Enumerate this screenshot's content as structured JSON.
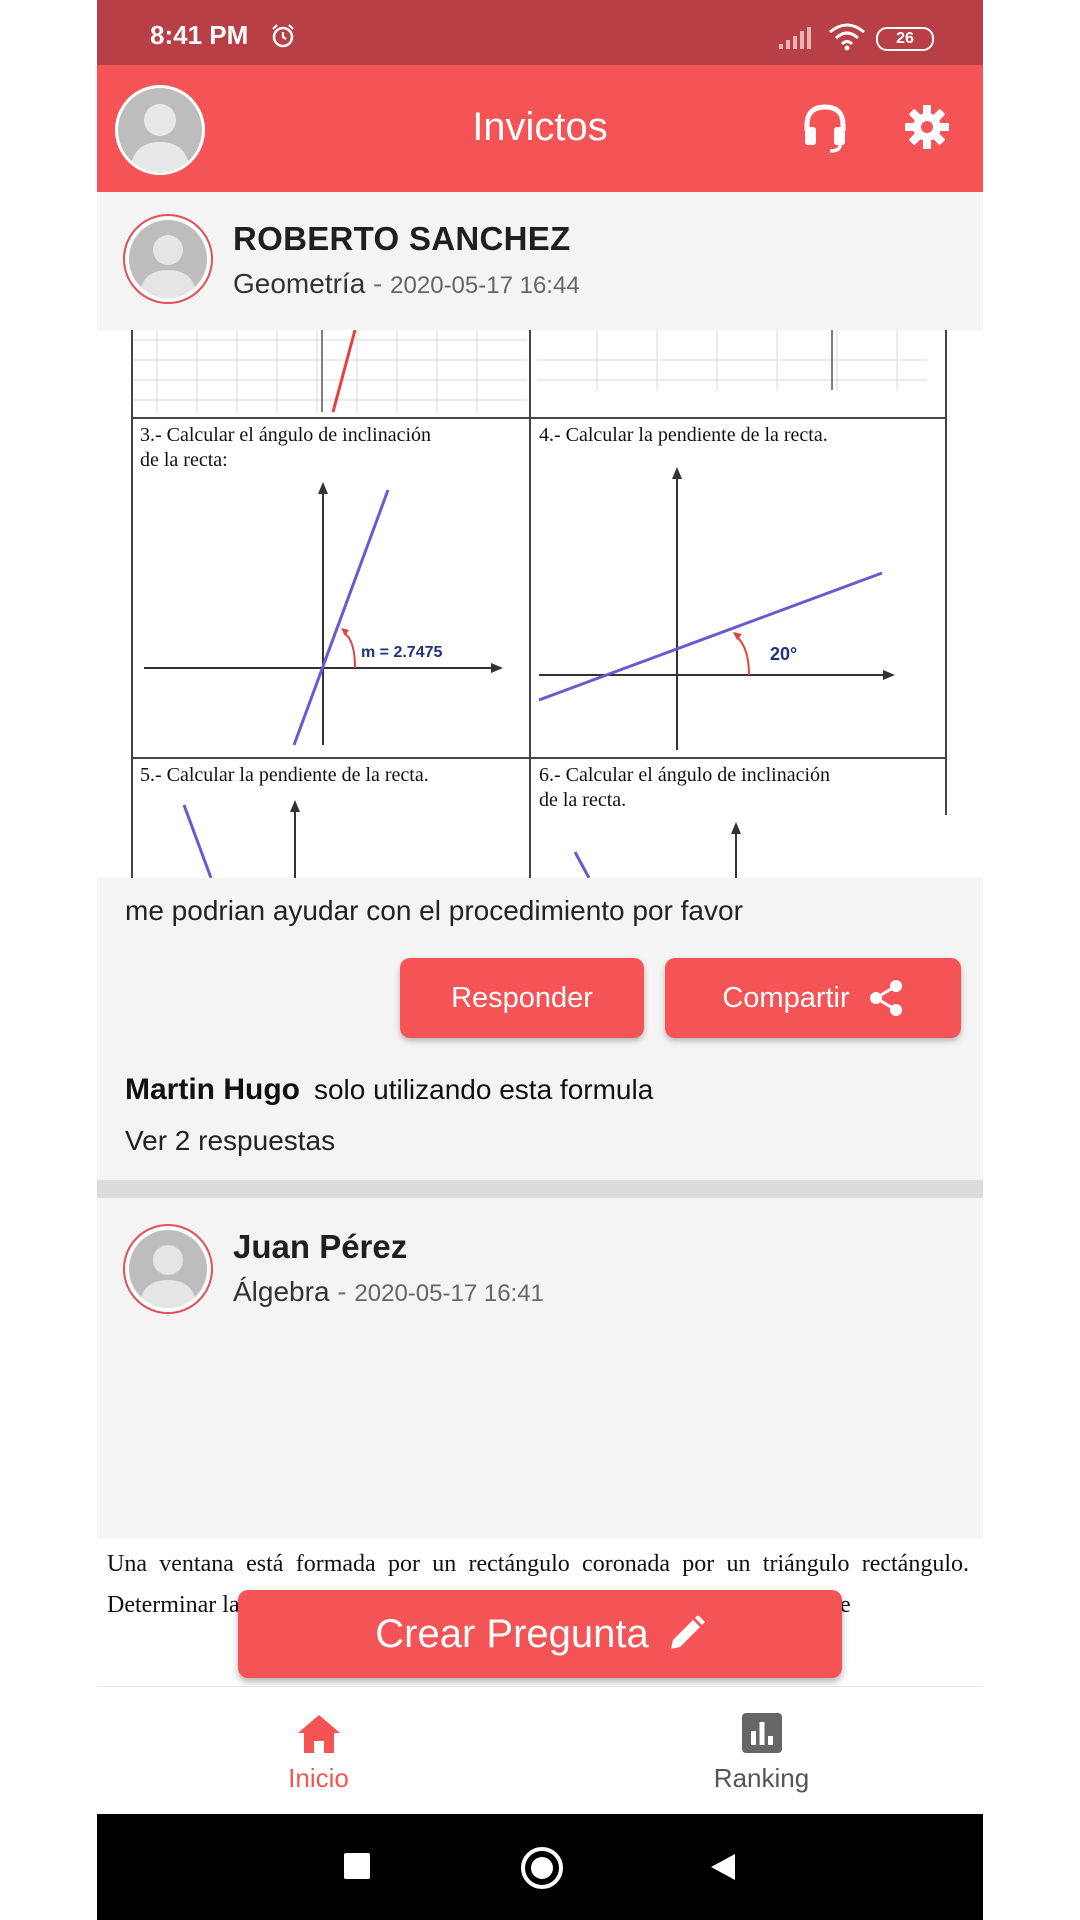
{
  "status_bar": {
    "time": "8:41 PM",
    "battery": "26"
  },
  "app_bar": {
    "title": "Invictos"
  },
  "post1": {
    "author": "ROBERTO SANCHEZ",
    "subject": "Geometría",
    "separator": " - ",
    "timestamp": "2020-05-17 16:44",
    "image_text": {
      "q3_title": "3.- Calcular el ángulo de inclinación",
      "q3_title2": "de la recta:",
      "q3_label": "m = 2.7475",
      "q4_title": "4.- Calcular la pendiente de la recta.",
      "q4_label": "20°",
      "q5_title": "5.- Calcular la pendiente de la recta.",
      "q6_title": "6.- Calcular el ángulo de inclinación",
      "q6_title2": "de la recta."
    },
    "text": "me podrian ayudar con el procedimiento por favor",
    "reply_label": "Responder",
    "share_label": "Compartir",
    "comment_author": "Martin Hugo",
    "comment_text": "solo utilizando esta formula",
    "see_replies": "Ver 2 respuestas"
  },
  "post2": {
    "author": "Juan Pérez",
    "subject": "Álgebra",
    "separator": " - ",
    "timestamp": "2020-05-17 16:41",
    "image_text": "Una ventana está formada por un rectángulo coronada por un triángulo rectángulo. Determinar las dimensiones de la ventana para que pase la mayor cantidad de"
  },
  "fab": {
    "label": "Crear Pregunta"
  },
  "bottom_nav": {
    "items": [
      {
        "label": "Inicio",
        "active": true
      },
      {
        "label": "Ranking",
        "active": false
      }
    ]
  },
  "colors": {
    "accent": "#f45455",
    "status_bar": "#b73f45"
  }
}
